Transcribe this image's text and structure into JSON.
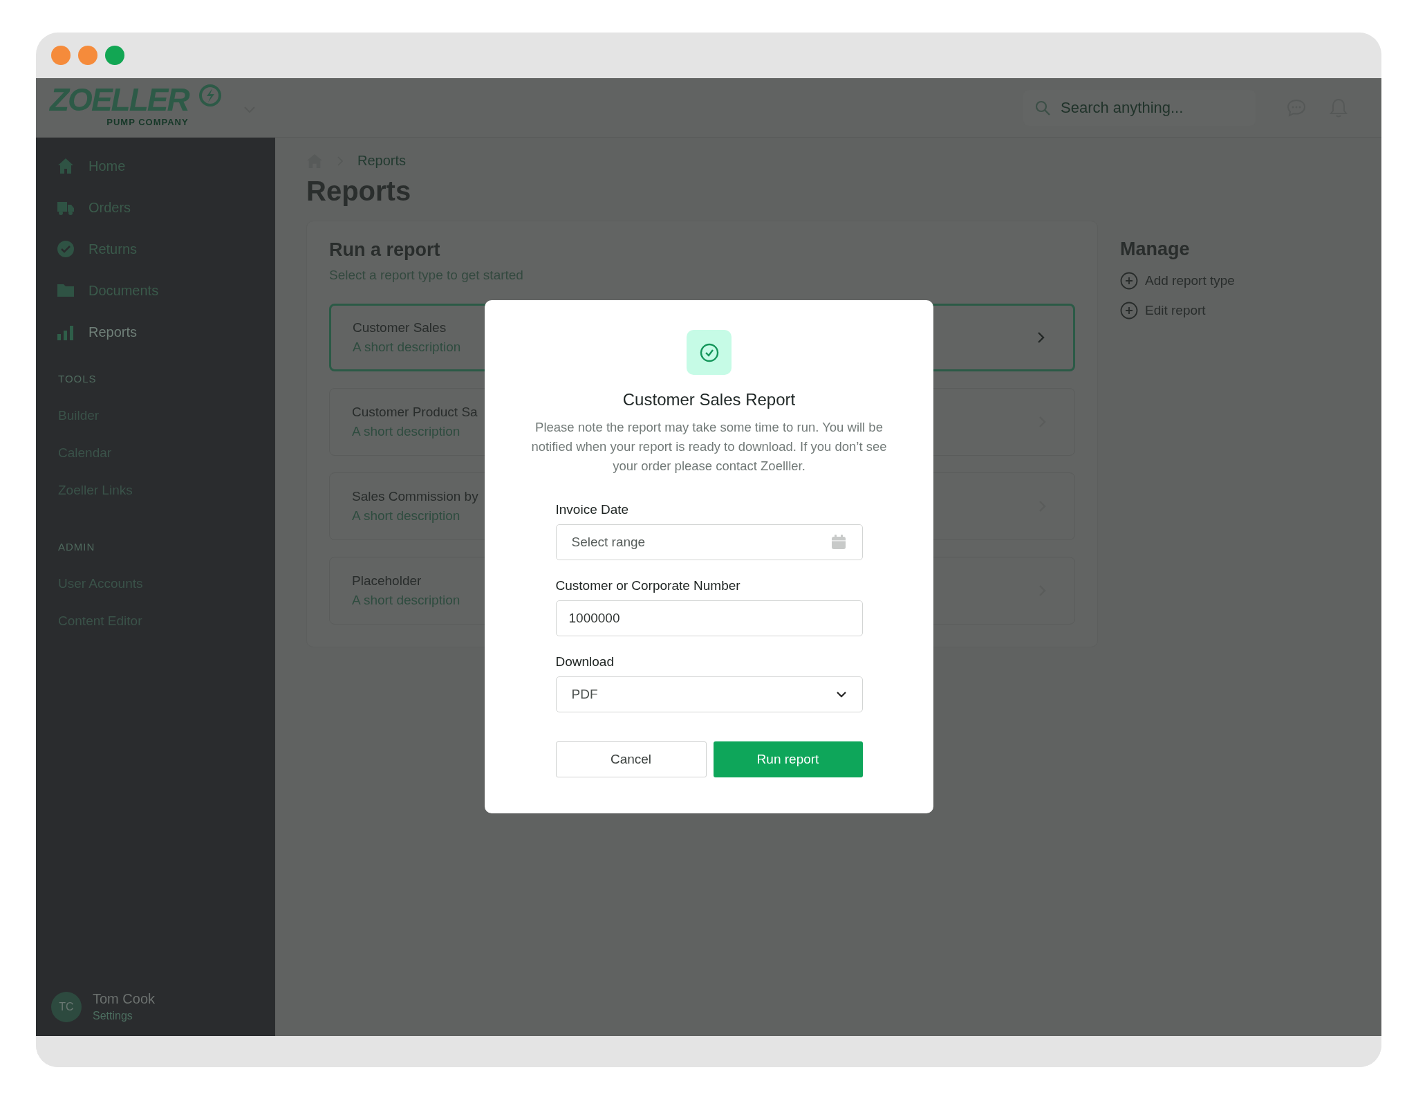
{
  "window": {
    "controls": [
      {
        "color": "#f58b3b"
      },
      {
        "color": "#f58b3b"
      },
      {
        "color": "#12a653"
      }
    ]
  },
  "header": {
    "logo": {
      "name": "ZOELLER",
      "tagline": "PUMP COMPANY"
    },
    "search": {
      "placeholder": "Search anything..."
    }
  },
  "sidebar": {
    "items": [
      {
        "kind": "home",
        "label": "Home",
        "selected": false
      },
      {
        "kind": "orders",
        "label": "Orders",
        "selected": false
      },
      {
        "kind": "returns",
        "label": "Returns",
        "selected": false
      },
      {
        "kind": "documents",
        "label": "Documents",
        "selected": false
      },
      {
        "kind": "reports",
        "label": "Reports",
        "selected": true
      }
    ],
    "sections": [
      {
        "title": "TOOLS",
        "items": [
          "Builder",
          "Calendar",
          "Zoeller Links"
        ]
      },
      {
        "title": "ADMIN",
        "items": [
          "User Accounts",
          "Content Editor"
        ]
      }
    ],
    "user": {
      "initials": "TC",
      "name": "Tom Cook",
      "link": "Settings"
    }
  },
  "breadcrumb": {
    "items": [
      "Reports"
    ]
  },
  "page_title": "Reports",
  "run_report": {
    "title": "Run a report",
    "subtitle": "Select a report type to get started",
    "reports": [
      {
        "title": "Customer Sales",
        "description": "A short description",
        "selected": true
      },
      {
        "title": "Customer Product Sa",
        "description": "A short description",
        "selected": false
      },
      {
        "title": "Sales Commission by",
        "description": "A short description",
        "selected": false
      },
      {
        "title": "Placeholder",
        "description": "A short description",
        "selected": false
      }
    ]
  },
  "manage": {
    "title": "Manage",
    "actions": [
      "Add report type",
      "Edit report"
    ]
  },
  "modal": {
    "title": "Customer Sales Report",
    "message": "Please note the report may take some time to run. You will be notified when your report is ready to download. If you don’t see your order please contact Zoelller.",
    "fields": [
      {
        "kind": "date",
        "label": "Invoice Date",
        "placeholder": "Select range"
      },
      {
        "kind": "text",
        "label": "Customer or Corporate Number",
        "value": "1000000"
      },
      {
        "kind": "select",
        "label": "Download",
        "value": "PDF"
      }
    ],
    "buttons": [
      {
        "kind": "secondary",
        "label": "Cancel"
      },
      {
        "kind": "primary",
        "label": "Run report"
      }
    ]
  }
}
